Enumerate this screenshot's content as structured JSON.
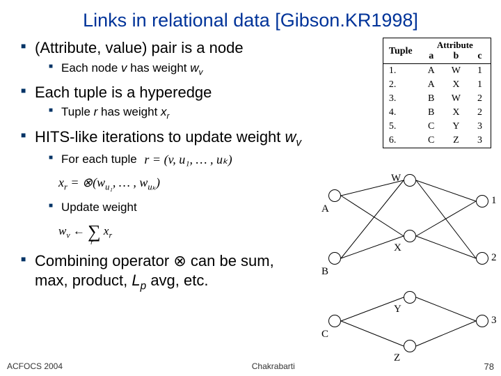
{
  "title": "Links in relational data [Gibson.KR1998]",
  "bullets": {
    "b1": "(Attribute, value) pair is a node",
    "b1a_pre": "Each node ",
    "b1a_v": "v",
    "b1a_mid": " has weight ",
    "b1a_w": "w",
    "b1a_sub": "v",
    "b2": "Each tuple is a hyperedge",
    "b2a_pre": "Tuple ",
    "b2a_r": "r",
    "b2a_mid": " has weight ",
    "b2a_x": "x",
    "b2a_sub": "r",
    "b3_pre": "HITS-like iterations to update weight ",
    "b3_w": "w",
    "b3_sub": "v",
    "b3a": "For each tuple",
    "b3b": "Update weight",
    "b4_pre": "Combining operator ",
    "b4_op": "⊗",
    "b4_post_1": " can be sum,",
    "b4_post_2": "max, product, ",
    "b4_lp": "L",
    "b4_lp_sub": "p",
    "b4_post_3": " avg, etc."
  },
  "formulas": {
    "f1": "r = (v, u₁, … , uₖ)",
    "f2a": "x",
    "f2a_sub": "r",
    "f2b": " = ⊗(w",
    "f2b_sub1": "u₁",
    "f2c": ", … , w",
    "f2c_sub2": "uₖ",
    "f2d": ")",
    "f3a": "w",
    "f3a_sub": "v",
    "f3b": " ← ",
    "f3sum_lim": "r",
    "f3c": " x",
    "f3c_sub": "r"
  },
  "table": {
    "group_left": "Tuple",
    "group_right": "Attribute",
    "cols": [
      "a",
      "b",
      "c"
    ],
    "rows": [
      {
        "t": "1.",
        "a": "A",
        "b": "W",
        "c": "1"
      },
      {
        "t": "2.",
        "a": "A",
        "b": "X",
        "c": "1"
      },
      {
        "t": "3.",
        "a": "B",
        "b": "W",
        "c": "2"
      },
      {
        "t": "4.",
        "a": "B",
        "b": "X",
        "c": "2"
      },
      {
        "t": "5.",
        "a": "C",
        "b": "Y",
        "c": "3"
      },
      {
        "t": "6.",
        "a": "C",
        "b": "Z",
        "c": "3"
      }
    ]
  },
  "diagram": {
    "nodes": {
      "A": "A",
      "B": "B",
      "C": "C",
      "W": "W",
      "X": "X",
      "Y": "Y",
      "Z": "Z",
      "n1": "1",
      "n2": "2",
      "n3": "3"
    }
  },
  "footer": {
    "left": "ACFOCS 2004",
    "mid": "Chakrabarti",
    "page": "78"
  }
}
